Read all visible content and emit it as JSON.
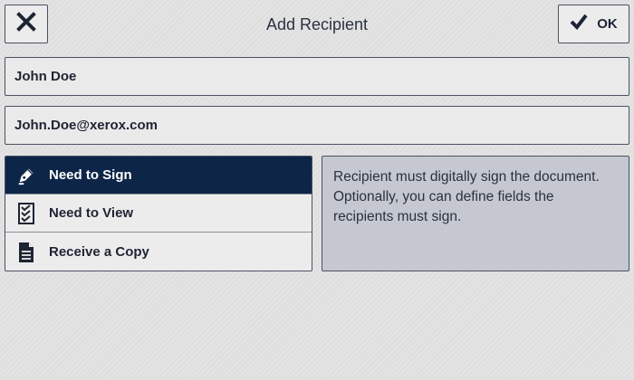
{
  "header": {
    "title": "Add Recipient",
    "close_icon": "close-icon",
    "ok_label": "OK",
    "ok_icon": "checkmark-icon"
  },
  "fields": {
    "name_value": "John Doe",
    "email_value": "John.Doe@xerox.com"
  },
  "options": [
    {
      "label": "Need to Sign",
      "icon": "pen-icon",
      "selected": true
    },
    {
      "label": "Need to View",
      "icon": "checklist-icon",
      "selected": false
    },
    {
      "label": "Receive a Copy",
      "icon": "document-icon",
      "selected": false
    }
  ],
  "description": "Recipient must digitally sign the document. Optionally, you can define fields the recipients must sign.",
  "colors": {
    "selected_background": "#0d2547",
    "description_background": "#c5c8d0"
  }
}
